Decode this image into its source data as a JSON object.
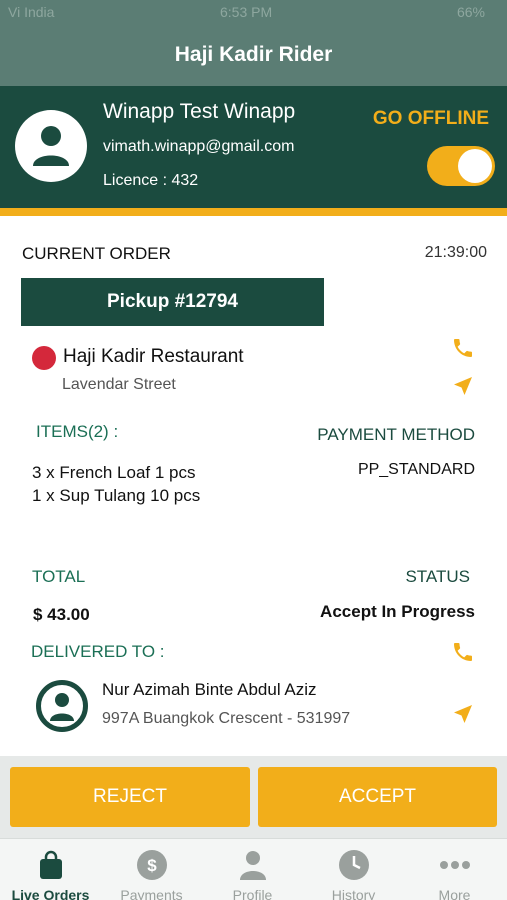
{
  "status_bar": {
    "carrier": "Vi India",
    "time": "6:53 PM",
    "battery": "66%"
  },
  "app_bar": {
    "title": "Haji Kadir Rider"
  },
  "profile": {
    "name": "Winapp Test Winapp",
    "email": "vimath.winapp@gmail.com",
    "licence": "Licence : 432",
    "go_offline_label": "GO OFFLINE",
    "online_toggle_on": true
  },
  "order": {
    "section_title": "CURRENT ORDER",
    "time": "21:39:00",
    "pickup_label": "Pickup #12794",
    "restaurant_name": "Haji Kadir Restaurant",
    "restaurant_street": "Lavendar Street",
    "items_label": "ITEMS(2) :",
    "items": [
      "3 x French Loaf 1 pcs",
      "1 x Sup Tulang 10 pcs"
    ],
    "payment_label": "PAYMENT METHOD",
    "payment_value": "PP_STANDARD",
    "total_label": "TOTAL",
    "total_value": "$ 43.00",
    "status_label": "STATUS",
    "status_value": "Accept In Progress",
    "delivered_label": "DELIVERED TO :",
    "customer_name": "Nur Azimah Binte Abdul Aziz",
    "customer_address": "997A Buangkok Crescent - 531997"
  },
  "actions": {
    "reject": "REJECT",
    "accept": "ACCEPT"
  },
  "tabs": [
    {
      "label": "Live Orders",
      "icon": "bag-icon"
    },
    {
      "label": "Payments",
      "icon": "dollar-icon"
    },
    {
      "label": "Profile",
      "icon": "person-icon"
    },
    {
      "label": "History",
      "icon": "clock-icon"
    },
    {
      "label": "More",
      "icon": "more-dots-icon"
    }
  ],
  "colors": {
    "primary": "#1b4b3f",
    "accent": "#f2ae1a"
  }
}
